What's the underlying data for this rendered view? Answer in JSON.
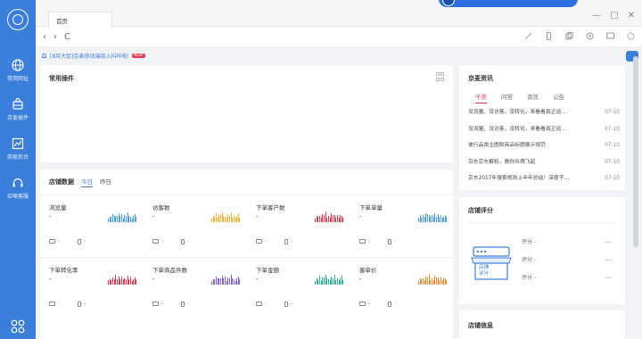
{
  "sidebar": {
    "items": [
      {
        "label": "常用网址",
        "icon": "globe-icon"
      },
      {
        "label": "京麦插件",
        "icon": "plugin-icon"
      },
      {
        "label": "商家后台",
        "icon": "chart-icon"
      },
      {
        "label": "召唤客服",
        "icon": "headset-icon"
      }
    ],
    "bottom_icon": "grid-apps-icon"
  },
  "tab": {
    "label": "首页"
  },
  "window": {
    "minimize": "—",
    "maximize": "□",
    "close": "✕"
  },
  "nav": {
    "back": "‹",
    "forward": "›",
    "refresh": "C"
  },
  "notice": {
    "text": "[8月大促]京麦移动端接入抖咔啦!",
    "badge": "NEW"
  },
  "plugins": {
    "title": "常用插件"
  },
  "store": {
    "title": "店铺数据",
    "tabs": [
      "今日",
      "昨日"
    ],
    "metrics": [
      {
        "name": "浏览量",
        "value": "-",
        "pc": "-",
        "mobile": "-",
        "color": "#4aa0e6"
      },
      {
        "name": "访客数",
        "value": "-",
        "pc": "-",
        "mobile": "-",
        "color": "#f2b330"
      },
      {
        "name": "下单客户数",
        "value": "-",
        "pc": "-",
        "mobile": "-",
        "color": "#e8364e"
      },
      {
        "name": "下单单量",
        "value": "-",
        "pc": "-",
        "mobile": "-",
        "color": "#4aa0e6"
      },
      {
        "name": "下单转化率",
        "value": "-",
        "pc": "-",
        "mobile": "-",
        "color": "#e8364e"
      },
      {
        "name": "下单商品件数",
        "value": "-",
        "pc": "-",
        "mobile": "-",
        "color": "#8a5fd6"
      },
      {
        "name": "下单金额",
        "value": "-",
        "pc": "-",
        "mobile": "-",
        "color": "#2bb89a"
      },
      {
        "name": "客单价",
        "value": "-",
        "pc": "-",
        "mobile": "-",
        "color": "#f28a30"
      }
    ]
  },
  "news": {
    "title": "京麦资讯",
    "tabs": [
      "干货",
      "问答",
      "资讯",
      "公告"
    ],
    "items": [
      {
        "title": "没流量、没访客、没转化，来看看真正运…",
        "date": "07-10"
      },
      {
        "title": "没流量、没访客、没转化，来看看真正运…",
        "date": "07-10"
      },
      {
        "title": "彼行品类主图和商品标题展示规范",
        "date": "07-10"
      },
      {
        "title": "京东京东解析，教你并得飞起",
        "date": "07-10"
      },
      {
        "title": "京东2017年搜索规则上半年总结！深度干…",
        "date": "07-10"
      }
    ]
  },
  "rating": {
    "title": "店铺评分",
    "shop_label": "店铺\n评分",
    "rows": [
      {
        "label": "评分",
        "sep": "-",
        "value": "---"
      },
      {
        "label": "评分",
        "sep": "-",
        "value": "---"
      },
      {
        "label": "评分",
        "sep": "-",
        "value": "---"
      }
    ]
  },
  "shopinfo": {
    "title": "店铺信息"
  }
}
